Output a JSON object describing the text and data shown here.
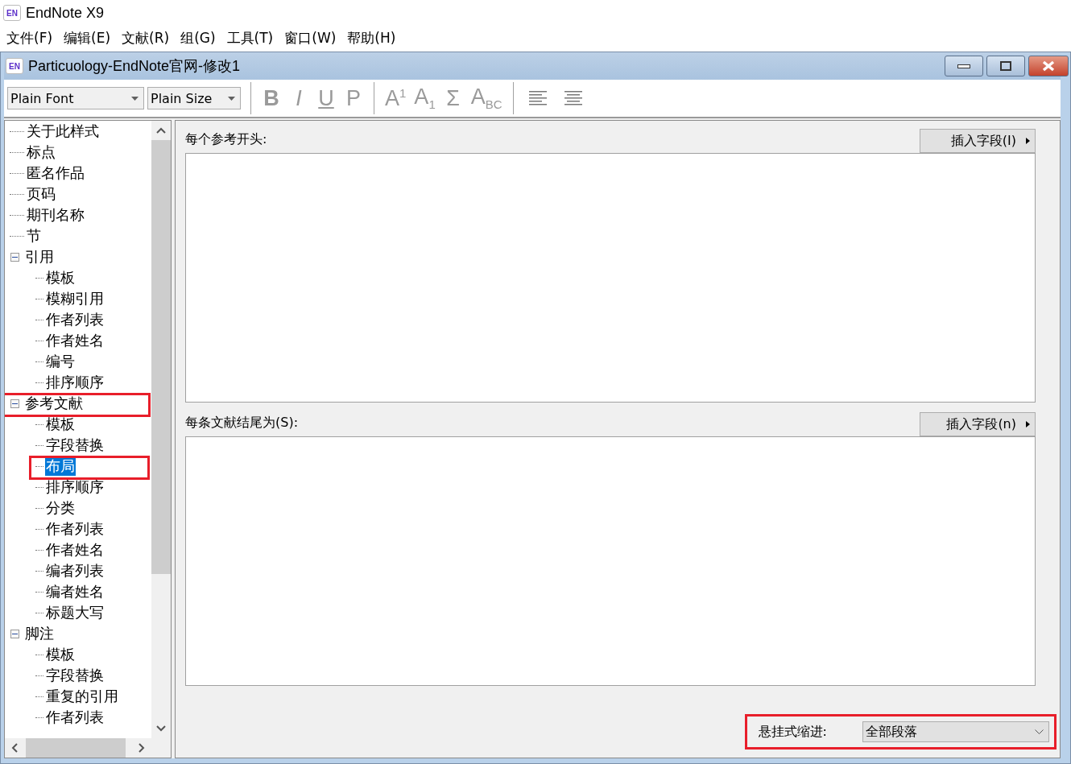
{
  "app": {
    "title": "EndNote X9",
    "logo": "EN"
  },
  "menu": [
    "文件(F)",
    "编辑(E)",
    "文献(R)",
    "组(G)",
    "工具(T)",
    "窗口(W)",
    "帮助(H)"
  ],
  "window": {
    "title": "Particuology-EndNote官网-修改1",
    "logo": "EN"
  },
  "toolbar": {
    "font": "Plain Font",
    "size": "Plain Size",
    "format_buttons": [
      {
        "label": "B",
        "kind": "bold"
      },
      {
        "label": "I",
        "kind": "italic"
      },
      {
        "label": "U",
        "kind": "underline"
      },
      {
        "label": "P",
        "kind": "plain"
      },
      {
        "label": "A$^{1}$",
        "kind": "rich"
      },
      {
        "label": "A$_{1}$",
        "kind": "rich"
      },
      {
        "label": "Σ",
        "kind": "symbol"
      },
      {
        "label": "A$_{BC}$",
        "kind": "rich"
      }
    ],
    "align_buttons": [
      {
        "kind": "left"
      },
      {
        "kind": "center"
      }
    ]
  },
  "tree": [
    {
      "label": "关于此样式",
      "selected": false,
      "highlighted": false
    },
    {
      "label": "标点",
      "selected": false,
      "highlighted": false
    },
    {
      "label": "匿名作品",
      "selected": false,
      "highlighted": false
    },
    {
      "label": "页码",
      "selected": false,
      "highlighted": false
    },
    {
      "label": "期刊名称",
      "selected": false,
      "highlighted": false
    },
    {
      "label": "节",
      "selected": false,
      "highlighted": false
    },
    {
      "label": "引用",
      "selected": false,
      "highlighted": false,
      "expanded": true,
      "children": [
        {
          "label": "模板",
          "selected": false,
          "highlighted": false
        },
        {
          "label": "模糊引用",
          "selected": false,
          "highlighted": false
        },
        {
          "label": "作者列表",
          "selected": false,
          "highlighted": false
        },
        {
          "label": "作者姓名",
          "selected": false,
          "highlighted": false
        },
        {
          "label": "编号",
          "selected": false,
          "highlighted": false
        },
        {
          "label": "排序顺序",
          "selected": false,
          "highlighted": false
        }
      ]
    },
    {
      "label": "参考文献",
      "selected": false,
      "highlighted": true,
      "expanded": true,
      "children": [
        {
          "label": "模板",
          "selected": false,
          "highlighted": false
        },
        {
          "label": "字段替换",
          "selected": false,
          "highlighted": false
        },
        {
          "label": "布局",
          "selected": true,
          "highlighted": true
        },
        {
          "label": "排序顺序",
          "selected": false,
          "highlighted": false
        },
        {
          "label": "分类",
          "selected": false,
          "highlighted": false
        },
        {
          "label": "作者列表",
          "selected": false,
          "highlighted": false
        },
        {
          "label": "作者姓名",
          "selected": false,
          "highlighted": false
        },
        {
          "label": "编者列表",
          "selected": false,
          "highlighted": false
        },
        {
          "label": "编者姓名",
          "selected": false,
          "highlighted": false
        },
        {
          "label": "标题大写",
          "selected": false,
          "highlighted": false
        }
      ]
    },
    {
      "label": "脚注",
      "selected": false,
      "highlighted": false,
      "expanded": true,
      "children": [
        {
          "label": "模板",
          "selected": false,
          "highlighted": false
        },
        {
          "label": "字段替换",
          "selected": false,
          "highlighted": false
        },
        {
          "label": "重复的引用",
          "selected": false,
          "highlighted": false
        },
        {
          "label": "作者列表",
          "selected": false,
          "highlighted": false
        }
      ]
    }
  ],
  "sections": [
    {
      "label": "每个参考开头:",
      "button": "插入字段(I)"
    },
    {
      "label": "每条文献结尾为(S):",
      "button": "插入字段(n)"
    }
  ],
  "hanging_indent": {
    "label": "悬挂式缩进:",
    "value": "全部段落",
    "highlighted": true
  }
}
